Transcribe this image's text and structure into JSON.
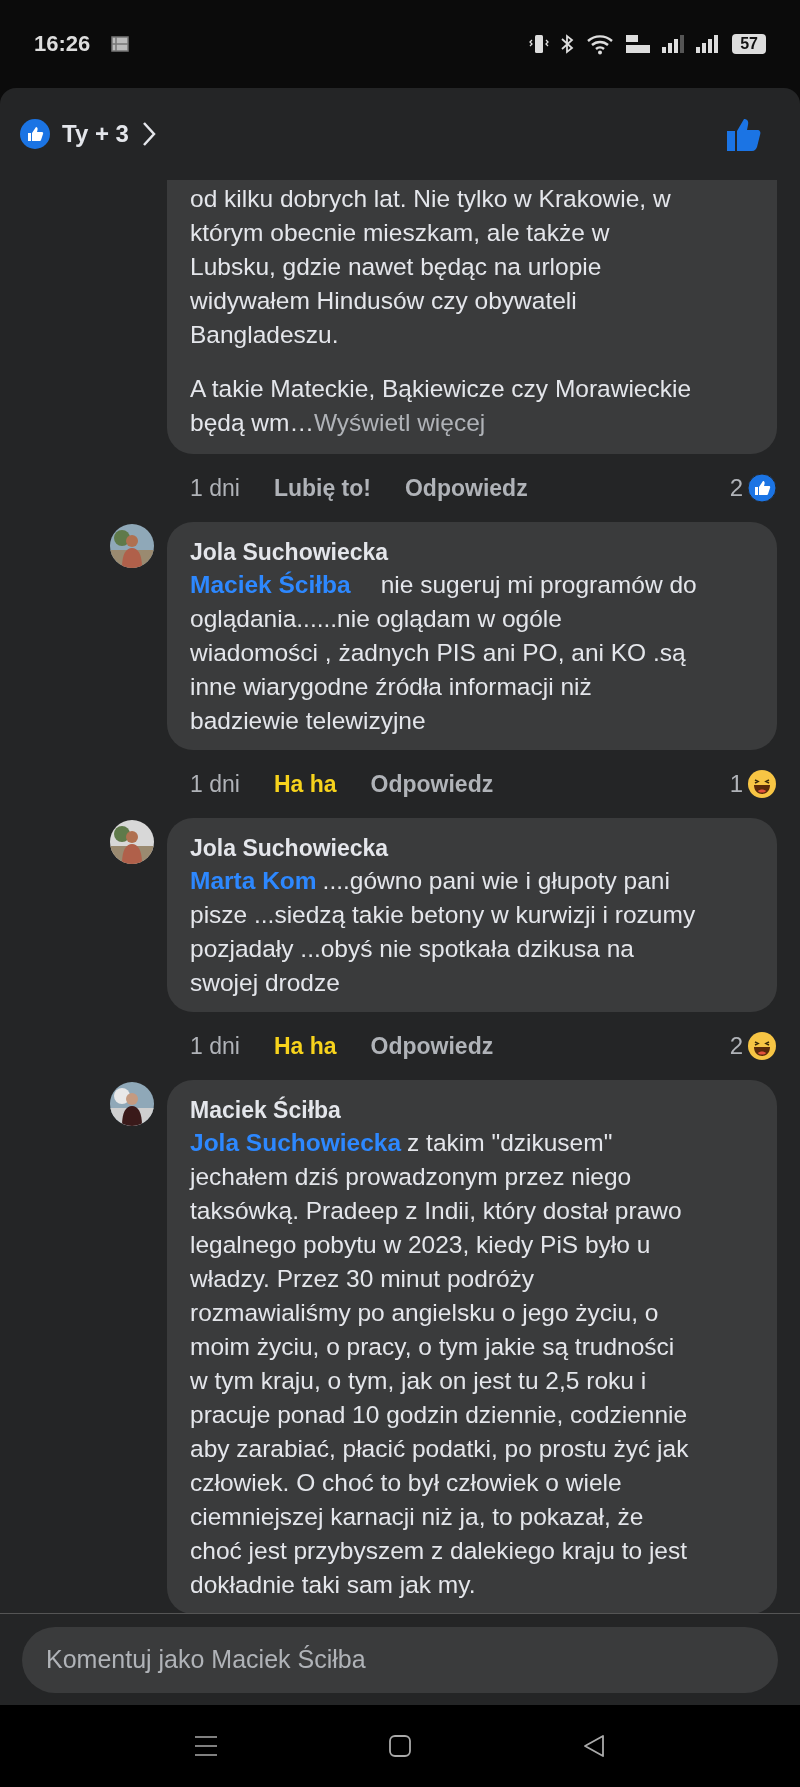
{
  "status_bar": {
    "time": "16:26",
    "battery": "57"
  },
  "header": {
    "like_summary": "Ty + 3"
  },
  "comments": [
    {
      "paragraphs": [
        [
          "od kilku dobrych lat. Nie tylko w Krakowie, w",
          "którym obecnie mieszkam, ale także w",
          "Lubsku, gdzie nawet będąc na urlopie",
          "widywałem Hindusów czy obywateli",
          "Bangladeszu."
        ],
        [
          "A takie Mateckie, Bąkiewicze czy Morawieckie",
          "będą wm…"
        ]
      ],
      "see_more": "Wyświetl więcej",
      "time": "1 dni",
      "reaction": {
        "label": "Lubię to!",
        "reacted": false
      },
      "reply": "Odpowiedz",
      "reactions": {
        "count": "2",
        "kind": "like"
      }
    },
    {
      "author": "Jola Suchowiecka",
      "mention": "Maciek Ściłba",
      "paragraphs": [
        [
          "nie sugeruj mi programów do",
          "oglądania......nie oglądam w ogóle",
          "wiadomości , żadnych PIS ani PO, ani KO .są",
          "inne wiarygodne źródła informacji niż",
          "badziewie telewizyjne"
        ]
      ],
      "time": "1 dni",
      "reaction": {
        "label": "Ha ha",
        "kind": "haha",
        "reacted": true
      },
      "reply": "Odpowiedz",
      "reactions": {
        "count": "1",
        "kind": "haha"
      }
    },
    {
      "author": "Jola Suchowiecka",
      "mention": "Marta Kom",
      "paragraphs": [
        [
          "....gówno pani wie i głupoty pani",
          "pisze ...siedzą takie betony w kurwizji i rozumy",
          "pozjadały ...obyś nie spotkała dzikusa na",
          "swojej drodze"
        ]
      ],
      "time": "1 dni",
      "reaction": {
        "label": "Ha ha",
        "kind": "haha",
        "reacted": true
      },
      "reply": "Odpowiedz",
      "reactions": {
        "count": "2",
        "kind": "haha"
      }
    },
    {
      "author": "Maciek Ściłba",
      "mention": "Jola Suchowiecka",
      "paragraphs": [
        [
          "z takim \"dzikusem\"",
          "jechałem dziś prowadzonym przez niego",
          "taksówką. Pradeep z Indii, który dostał prawo",
          "legalnego pobytu w 2023, kiedy PiS było u",
          "władzy. Przez 30 minut podróży",
          "rozmawialiśmy po angielsku o jego życiu, o",
          "moim życiu, o pracy, o tym jakie są trudności",
          "w tym kraju, o tym, jak on jest tu 2,5 roku i",
          "pracuje ponad 10 godzin dziennie, codziennie",
          "aby zarabiać, płacić podatki, po prostu żyć jak",
          "człowiek. O choć to był człowiek o wiele",
          "ciemniejszej karnacji niż ja, to pokazał, że",
          "choć jest przybyszem z dalekiego kraju to jest",
          "dokładnie taki sam jak my."
        ]
      ]
    }
  ],
  "comment_input": {
    "placeholder": "Komentuj jako Maciek Ściłba"
  }
}
